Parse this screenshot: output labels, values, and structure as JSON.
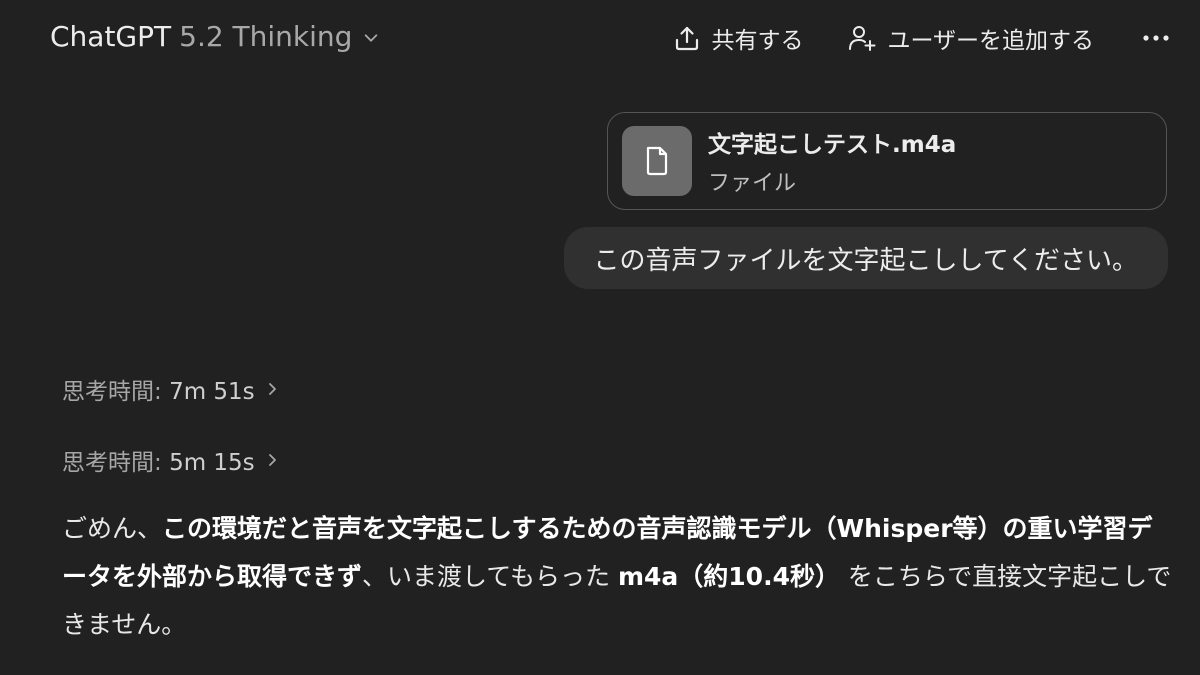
{
  "header": {
    "model_name": "ChatGPT",
    "model_version": "5.2 Thinking",
    "share_label": "共有する",
    "add_user_label": "ユーザーを追加する",
    "more_icon": "more-horizontal-icon"
  },
  "attachment": {
    "file_name": "文字起こしテスト.m4a",
    "file_type": "ファイル",
    "icon": "document-icon"
  },
  "user_message": {
    "text": "この音声ファイルを文字起こししてください。"
  },
  "thinking": [
    {
      "label": "思考時間: ",
      "time": "7m 51s"
    },
    {
      "label": "思考時間: ",
      "time": "5m 15s"
    }
  ],
  "assistant_message": {
    "seg1": "ごめん、",
    "seg2_bold": "この環境だと音声を文字起こしするための音声認識モデル（Whisper等）の重い学習データを外部から取得できず",
    "seg3": "、いま渡してもらった ",
    "seg4_bold": "m4a（約10.4秒）",
    "seg5": " をこちらで直接文字起こしできません。"
  },
  "colors": {
    "background": "#212121",
    "bubble": "#303030",
    "file_thumb": "#6b6b6b",
    "text_primary": "#ececec",
    "text_muted": "#a6a6a6"
  }
}
